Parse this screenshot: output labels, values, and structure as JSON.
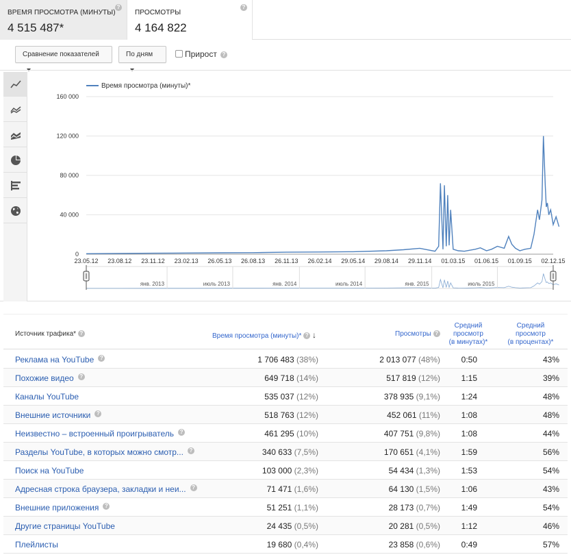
{
  "metrics": [
    {
      "title": "ВРЕМЯ ПРОСМОТРА (МИНУТЫ)",
      "value": "4 515 487*"
    },
    {
      "title": "ПРОСМОТРЫ",
      "value": "4 164 822"
    }
  ],
  "controls": {
    "compare_label": "Сравнение показателей",
    "period_label": "По дням",
    "growth_label": "Прирост"
  },
  "sidebar_icons": [
    "line-chart-icon",
    "multiline-chart-icon",
    "area-chart-icon",
    "pie-chart-icon",
    "bar-chart-icon",
    "globe-icon"
  ],
  "chart_data": {
    "type": "line",
    "legend": "Время просмотра (минуты)*",
    "ylim": [
      0,
      160000
    ],
    "yticks": [
      0,
      40000,
      80000,
      120000,
      160000
    ],
    "ytick_labels": [
      "0",
      "40 000",
      "80 000",
      "120 000",
      "160 000"
    ],
    "xtick_labels": [
      "23.05.12",
      "23.08.12",
      "23.11.12",
      "23.02.13",
      "26.05.13",
      "26.08.13",
      "26.11.13",
      "26.02.14",
      "29.05.14",
      "29.08.14",
      "29.11.14",
      "01.03.15",
      "01.06.15",
      "01.09.15",
      "02.12.15"
    ],
    "series": [
      {
        "name": "Время просмотра (минуты)*",
        "x": [
          "23.05.12",
          "23.08.12",
          "23.11.12",
          "23.02.13",
          "26.05.13",
          "26.08.13",
          "26.11.13",
          "26.02.14",
          "29.05.14",
          "29.08.14",
          "15.10.14",
          "29.11.14",
          "10.01.15",
          "20.01.15",
          "25.01.15",
          "01.02.15",
          "05.02.15",
          "10.02.15",
          "14.02.15",
          "18.02.15",
          "22.02.15",
          "01.03.15",
          "15.03.15",
          "01.04.15",
          "15.04.15",
          "01.05.15",
          "15.05.15",
          "01.06.15",
          "15.06.15",
          "01.07.15",
          "20.07.15",
          "01.08.15",
          "10.08.15",
          "20.08.15",
          "01.09.15",
          "15.09.15",
          "01.10.15",
          "10.10.15",
          "20.10.15",
          "25.10.15",
          "01.11.15",
          "05.11.15",
          "10.11.15",
          "13.11.15",
          "16.11.15",
          "20.11.15",
          "25.11.15",
          "02.12.15",
          "10.12.15",
          "18.12.15"
        ],
        "values": [
          500,
          800,
          1000,
          1200,
          1400,
          1500,
          2000,
          2200,
          2500,
          3500,
          4500,
          6000,
          3000,
          8000,
          72000,
          5000,
          70000,
          8000,
          60000,
          9000,
          45000,
          5000,
          3500,
          3000,
          4000,
          5000,
          6500,
          3500,
          5000,
          8000,
          6000,
          18000,
          10000,
          6000,
          3500,
          5000,
          6000,
          20000,
          45000,
          35000,
          55000,
          120000,
          70000,
          48000,
          52000,
          40000,
          45000,
          30000,
          38000,
          28000
        ]
      }
    ],
    "navigator_labels": [
      "янв. 2013",
      "июль 2013",
      "янв. 2014",
      "июль 2014",
      "янв. 2015",
      "июль 2015"
    ]
  },
  "table": {
    "headers": {
      "source": "Источник трафика*",
      "watch": "Время просмотра (минуты)*",
      "views": "Просмотры",
      "avg_dur": [
        "Средний",
        "просмотр",
        "(в минутах)*"
      ],
      "avg_pct": [
        "Средний",
        "просмотр",
        "(в процентах)*"
      ]
    },
    "rows": [
      {
        "name": "Реклама на YouTube",
        "help": true,
        "watch": "1 706 483",
        "watch_pct": "(38%)",
        "views": "2 013 077",
        "views_pct": "(48%)",
        "dur": "0:50",
        "pct": "43%"
      },
      {
        "name": "Похожие видео",
        "help": true,
        "watch": "649 718",
        "watch_pct": "(14%)",
        "views": "517 819",
        "views_pct": "(12%)",
        "dur": "1:15",
        "pct": "39%"
      },
      {
        "name": "Каналы YouTube",
        "help": false,
        "watch": "535 037",
        "watch_pct": "(12%)",
        "views": "378 935",
        "views_pct": "(9,1%)",
        "dur": "1:24",
        "pct": "48%"
      },
      {
        "name": "Внешние источники",
        "help": true,
        "watch": "518 763",
        "watch_pct": "(12%)",
        "views": "452 061",
        "views_pct": "(11%)",
        "dur": "1:08",
        "pct": "48%"
      },
      {
        "name": "Неизвестно – встроенный проигрыватель",
        "help": true,
        "watch": "461 295",
        "watch_pct": "(10%)",
        "views": "407 751",
        "views_pct": "(9,8%)",
        "dur": "1:08",
        "pct": "44%"
      },
      {
        "name": "Разделы YouTube, в которых можно смотр...",
        "help": true,
        "watch": "340 633",
        "watch_pct": "(7,5%)",
        "views": "170 651",
        "views_pct": "(4,1%)",
        "dur": "1:59",
        "pct": "56%"
      },
      {
        "name": "Поиск на YouTube",
        "help": false,
        "watch": "103 000",
        "watch_pct": "(2,3%)",
        "views": "54 434",
        "views_pct": "(1,3%)",
        "dur": "1:53",
        "pct": "54%"
      },
      {
        "name": "Адресная строка браузера, закладки и неи...",
        "help": true,
        "watch": "71 471",
        "watch_pct": "(1,6%)",
        "views": "64 130",
        "views_pct": "(1,5%)",
        "dur": "1:06",
        "pct": "43%"
      },
      {
        "name": "Внешние приложения",
        "help": true,
        "watch": "51 251",
        "watch_pct": "(1,1%)",
        "views": "28 173",
        "views_pct": "(0,7%)",
        "dur": "1:49",
        "pct": "54%"
      },
      {
        "name": "Другие страницы YouTube",
        "help": false,
        "watch": "24 435",
        "watch_pct": "(0,5%)",
        "views": "20 281",
        "views_pct": "(0,5%)",
        "dur": "1:12",
        "pct": "46%"
      },
      {
        "name": "Плейлисты",
        "help": false,
        "watch": "19 680",
        "watch_pct": "(0,4%)",
        "views": "23 858",
        "views_pct": "(0,6%)",
        "dur": "0:49",
        "pct": "57%"
      }
    ]
  },
  "colors": {
    "series": "#4f81bd",
    "link": "#2a5db0"
  }
}
